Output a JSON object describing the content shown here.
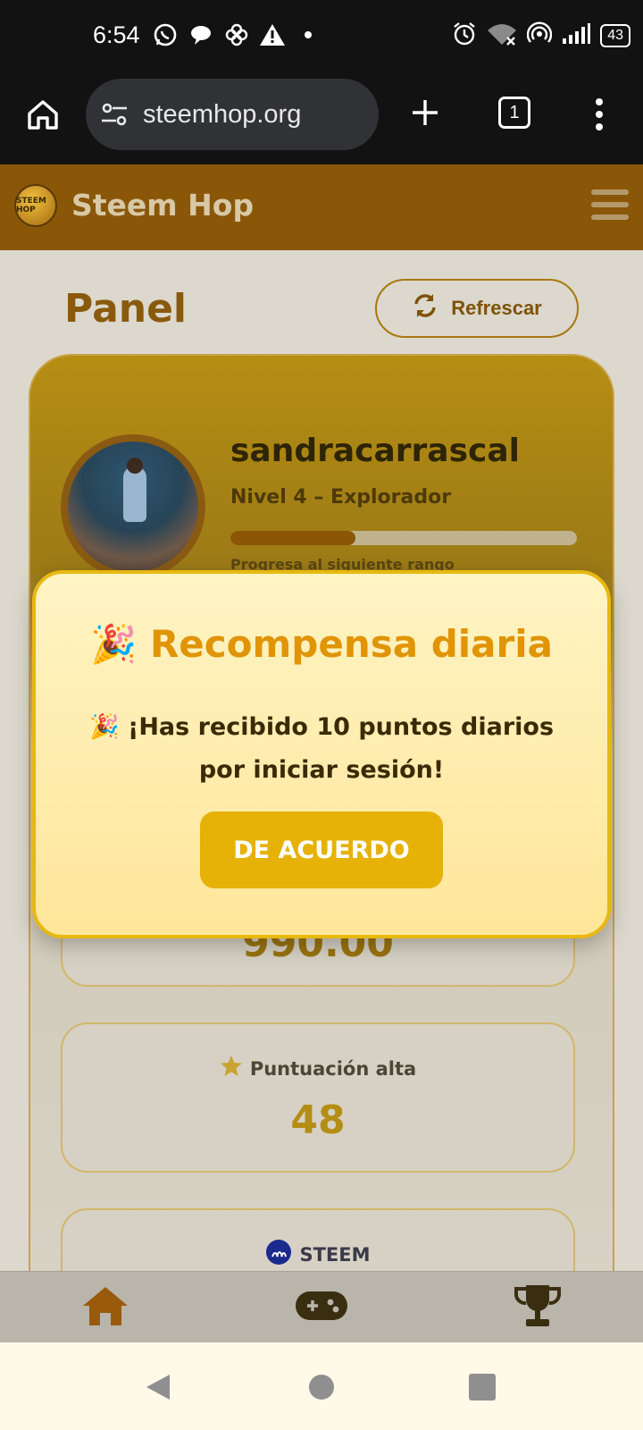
{
  "status_bar": {
    "time": "6:54",
    "battery": "43"
  },
  "browser": {
    "url": "steemhop.org",
    "tab_count": "1"
  },
  "app": {
    "brand": "Steem Hop",
    "logo_text": "STEEM HOP"
  },
  "panel": {
    "title": "Panel",
    "refresh_label": "Refrescar"
  },
  "profile": {
    "username": "sandracarrascal",
    "level": "Nivel 4 – Explorador",
    "progress_fraction": 0.36,
    "progress_label": "Progresa al siguiente rango"
  },
  "stats": {
    "points_value": "990.00",
    "high_score_label": "Puntuación alta",
    "high_score_value": "48",
    "steem_label": "STEEM"
  },
  "modal": {
    "title": "Recompensa diaria",
    "title_emoji": "🎉",
    "message": "🎉 ¡Has recibido 10 puntos diarios por iniciar sesión!",
    "button": "DE ACUERDO"
  },
  "bottom_nav": {
    "items": [
      {
        "icon": "home-icon",
        "active": true
      },
      {
        "icon": "gamepad-icon",
        "active": false
      },
      {
        "icon": "trophy-icon",
        "active": false
      }
    ]
  },
  "colors": {
    "accent": "#e6b208",
    "header": "#8a5709",
    "title": "#8a5a0c"
  }
}
